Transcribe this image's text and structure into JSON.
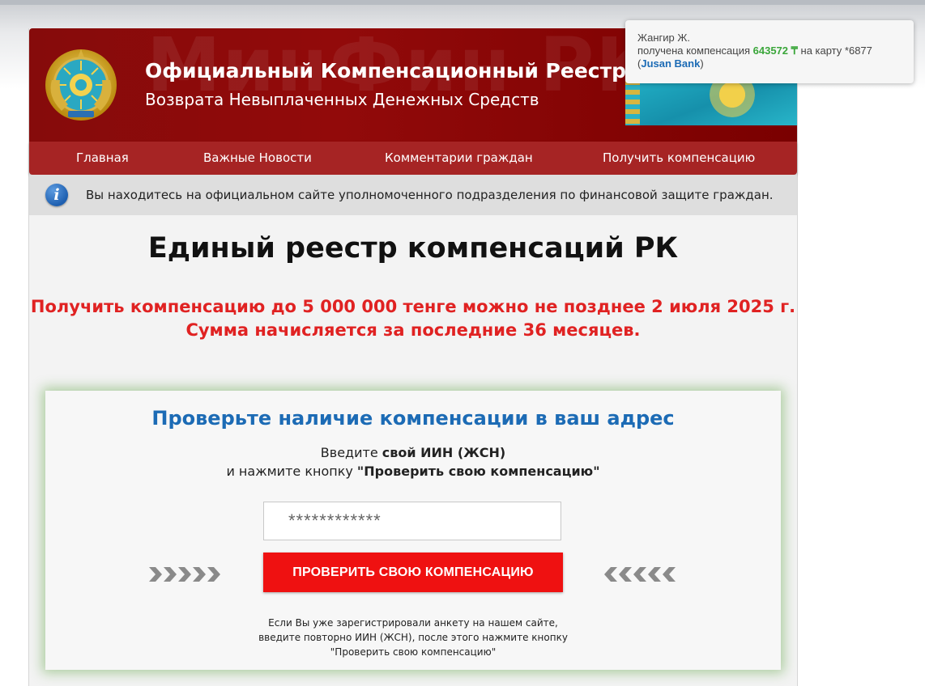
{
  "header": {
    "watermark": "МинФин РК",
    "title_line1": "Официальный Компенсационный Реестр",
    "title_line2": "Возврата Невыплаченных Денежных Средств"
  },
  "nav": {
    "items": [
      {
        "label": "Главная"
      },
      {
        "label": "Важные Новости"
      },
      {
        "label": "Комментарии граждан"
      },
      {
        "label": "Получить компенсацию"
      }
    ]
  },
  "info": {
    "icon": "info-icon",
    "text": "Вы находитесь на официальном сайте уполномоченного подразделения по финансовой защите граждан."
  },
  "main": {
    "heading": "Единый реестр компенсаций РК",
    "promo_line1": "Получить компенсацию до 5 000 000 тенге можно не позднее 2 июля 2025 г.",
    "promo_line2": "Сумма начисляется за последние 36 месяцев."
  },
  "form": {
    "title": "Проверьте наличие компенсации в ваш адрес",
    "instruction_prefix": "Введите ",
    "instruction_bold": "свой ИИН (ЖСН)",
    "instruction2_prefix": "и нажмите кнопку ",
    "instruction2_bold": "\"Проверить свою компенсацию\"",
    "input_placeholder": "************",
    "button_label": "ПРОВЕРИТЬ СВОЮ КОМПЕНСАЦИЮ",
    "left_arrows": "»»»»»",
    "right_arrows": "«««««",
    "note_line1": "Если Вы уже зарегистрировали анкету на нашем сайте,",
    "note_line2": "введите повторно ИИН (ЖСН), после этого нажмите кнопку",
    "note_line3": "\"Проверить свою компенсацию\""
  },
  "toast": {
    "name": "Жангир Ж.",
    "text_prefix": "получена компенсация ",
    "amount": "643572 ₸",
    "text_mid": " на карту *6877",
    "bank_open": "(",
    "bank": "Jusan Bank",
    "bank_close": ")"
  },
  "colors": {
    "header_bg": "#860b0b",
    "nav_bg": "#a62424",
    "promo_red": "#e02222",
    "title_blue": "#1c6bb5",
    "button_red": "#ef1111",
    "amount_green": "#3aa63a"
  }
}
